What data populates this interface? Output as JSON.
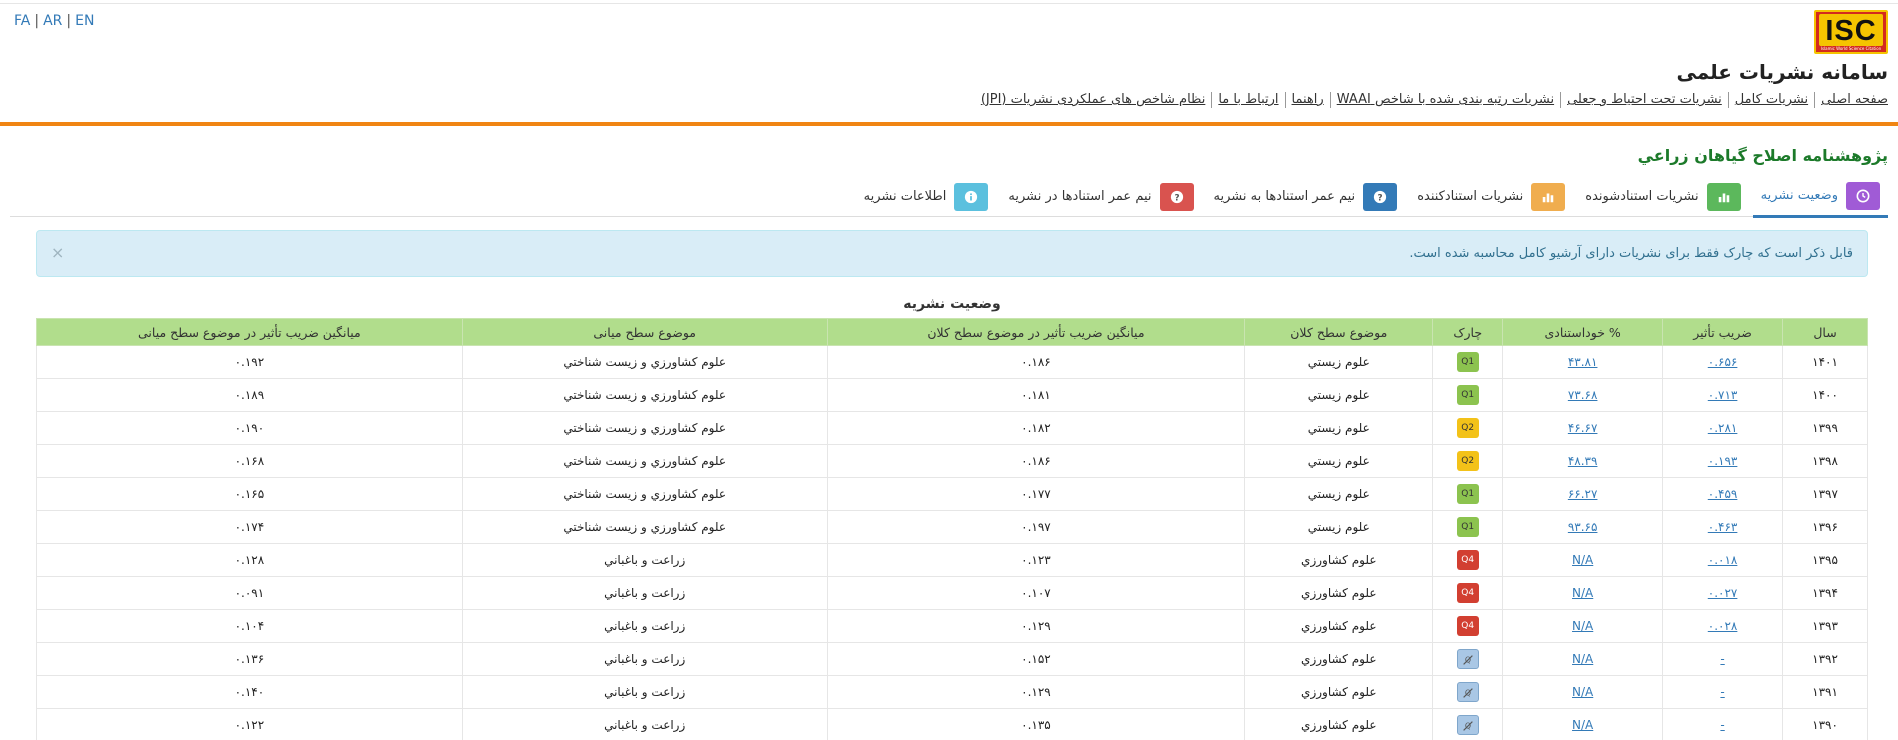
{
  "languages": [
    "FA",
    "AR",
    "EN"
  ],
  "logo_text": "ISC",
  "logo_subtext": "Islamic World Science Citation Center",
  "site_title": "سامانه نشريات علمی",
  "nav": [
    "صفحه اصلی",
    "نشريات کامل",
    "نشريات تحت احتياط و جعلی",
    "نشريات رتبه بندی شده با شاخص WAAI",
    "راهنما",
    "ارتباط با ما",
    "نظام شاخص های عملکردی نشريات (JPI)"
  ],
  "journal_title": "پژوهشنامه اصلاح گياهان زراعي",
  "tabs": [
    {
      "label": "وضعيت نشريه",
      "color": "#a05bd6",
      "icon": "clock-icon",
      "active": true
    },
    {
      "label": "نشريات استنادشونده",
      "color": "#5cb85c",
      "icon": "bar-chart-icon",
      "active": false
    },
    {
      "label": "نشريات استنادكننده",
      "color": "#f0ad4e",
      "icon": "bar-chart-icon",
      "active": false
    },
    {
      "label": "نيم عمر استنادها به نشريه",
      "color": "#337ab7",
      "icon": "question-icon",
      "active": false
    },
    {
      "label": "نيم عمر استنادها در نشريه",
      "color": "#d9534f",
      "icon": "question-icon",
      "active": false
    },
    {
      "label": "اطلاعات نشريه",
      "color": "#5bc0de",
      "icon": "info-icon",
      "active": false
    }
  ],
  "alert": {
    "text": "قابل ذکر است که چارک فقط برای نشريات دارای آرشيو کامل محاسبه شده است.",
    "close": "×"
  },
  "table": {
    "caption": "وضعيت نشريه",
    "headers": [
      "سال",
      "ضريب تأثير",
      "% خوداستنادی",
      "چارک",
      "موضوع سطح کلان",
      "ميانگين ضريب تأثير در موضوع سطح کلان",
      "موضوع سطح ميانی",
      "ميانگين ضريب تأثير در موضوع سطح ميانی"
    ],
    "rows": [
      {
        "year": "۱۴۰۱",
        "if": "۰.۶۵۶",
        "self": "۴۳.۸۱",
        "q": "Q1",
        "macro": "علوم زيستي",
        "macro_avg": "۰.۱۸۶",
        "mid": "علوم كشاورزي و زيست شناختي",
        "mid_avg": "۰.۱۹۲"
      },
      {
        "year": "۱۴۰۰",
        "if": "۰.۷۱۳",
        "self": "۷۳.۶۸",
        "q": "Q1",
        "macro": "علوم زيستي",
        "macro_avg": "۰.۱۸۱",
        "mid": "علوم كشاورزي و زيست شناختي",
        "mid_avg": "۰.۱۸۹"
      },
      {
        "year": "۱۳۹۹",
        "if": "۰.۲۸۱",
        "self": "۴۶.۶۷",
        "q": "Q2",
        "macro": "علوم زيستي",
        "macro_avg": "۰.۱۸۲",
        "mid": "علوم كشاورزي و زيست شناختي",
        "mid_avg": "۰.۱۹۰"
      },
      {
        "year": "۱۳۹۸",
        "if": "۰.۱۹۳",
        "self": "۴۸.۳۹",
        "q": "Q2",
        "macro": "علوم زيستي",
        "macro_avg": "۰.۱۸۶",
        "mid": "علوم كشاورزي و زيست شناختي",
        "mid_avg": "۰.۱۶۸"
      },
      {
        "year": "۱۳۹۷",
        "if": "۰.۴۵۹",
        "self": "۶۶.۲۷",
        "q": "Q1",
        "macro": "علوم زيستي",
        "macro_avg": "۰.۱۷۷",
        "mid": "علوم كشاورزي و زيست شناختي",
        "mid_avg": "۰.۱۶۵"
      },
      {
        "year": "۱۳۹۶",
        "if": "۰.۴۶۳",
        "self": "۹۳.۶۵",
        "q": "Q1",
        "macro": "علوم زيستي",
        "macro_avg": "۰.۱۹۷",
        "mid": "علوم كشاورزي و زيست شناختي",
        "mid_avg": "۰.۱۷۴"
      },
      {
        "year": "۱۳۹۵",
        "if": "۰.۰۱۸",
        "self": "N/A",
        "q": "Q4",
        "macro": "علوم كشاورزي",
        "macro_avg": "۰.۱۲۳",
        "mid": "زراعت و باغباني",
        "mid_avg": "۰.۱۲۸"
      },
      {
        "year": "۱۳۹۴",
        "if": "۰.۰۲۷",
        "self": "N/A",
        "q": "Q4",
        "macro": "علوم كشاورزي",
        "macro_avg": "۰.۱۰۷",
        "mid": "زراعت و باغباني",
        "mid_avg": "۰.۰۹۱"
      },
      {
        "year": "۱۳۹۳",
        "if": "۰.۰۲۸",
        "self": "N/A",
        "q": "Q4",
        "macro": "علوم كشاورزي",
        "macro_avg": "۰.۱۲۹",
        "mid": "زراعت و باغباني",
        "mid_avg": "۰.۱۰۴"
      },
      {
        "year": "۱۳۹۲",
        "if": "-",
        "self": "N/A",
        "q": "",
        "macro": "علوم كشاورزي",
        "macro_avg": "۰.۱۵۲",
        "mid": "زراعت و باغباني",
        "mid_avg": "۰.۱۳۶"
      },
      {
        "year": "۱۳۹۱",
        "if": "-",
        "self": "N/A",
        "q": "",
        "macro": "علوم كشاورزي",
        "macro_avg": "۰.۱۲۹",
        "mid": "زراعت و باغباني",
        "mid_avg": "۰.۱۴۰"
      },
      {
        "year": "۱۳۹۰",
        "if": "-",
        "self": "N/A",
        "q": "",
        "macro": "علوم كشاورزي",
        "macro_avg": "۰.۱۳۵",
        "mid": "زراعت و باغباني",
        "mid_avg": "۰.۱۲۲"
      }
    ]
  }
}
